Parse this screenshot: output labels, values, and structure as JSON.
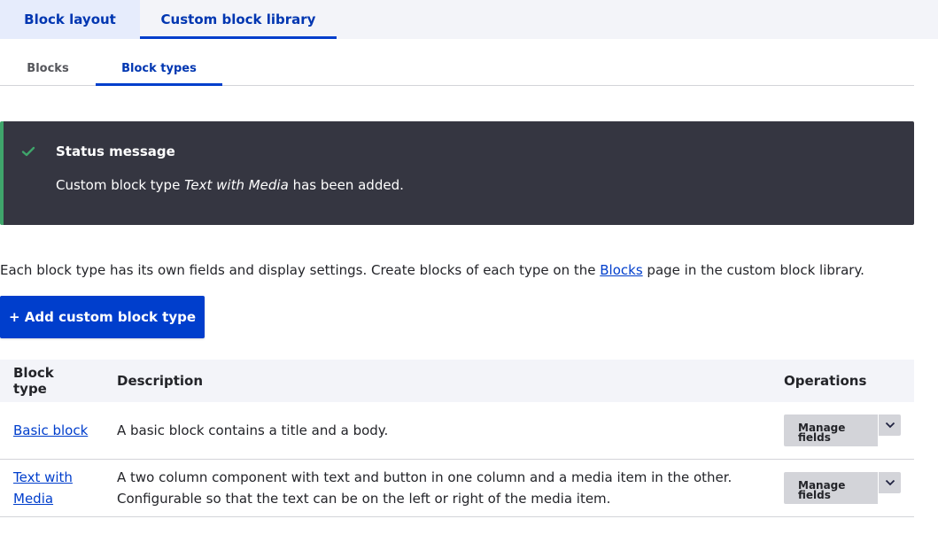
{
  "primary_tabs": [
    {
      "label": "Block layout",
      "active": false
    },
    {
      "label": "Custom block library",
      "active": true
    }
  ],
  "secondary_tabs": [
    {
      "label": "Blocks",
      "active": false
    },
    {
      "label": "Block types",
      "active": true
    }
  ],
  "status": {
    "title": "Status message",
    "message_before": "Custom block type ",
    "message_emphasis": "Text with Media",
    "message_after": " has been added.",
    "icon": "check-icon",
    "accent_color": "#3fa56b"
  },
  "intro": {
    "text_before": "Each block type has its own fields and display settings. Create blocks of each type on the ",
    "link_text": "Blocks",
    "text_after": " page in the custom block library."
  },
  "add_button": {
    "label": "+ Add custom block type",
    "color": "#003ecc"
  },
  "table": {
    "headers": [
      "Block type",
      "Description",
      "Operations"
    ],
    "rows": [
      {
        "type": "Basic block",
        "description": "A basic block contains a title and a body.",
        "operation": "Manage fields"
      },
      {
        "type": "Text with Media",
        "description_line1": "A two column component with text and button in one column and a media item in the other.",
        "description_line2": "Configurable so that the text can be on the left or right of the media item.",
        "operation": "Manage fields"
      }
    ],
    "operation_line1": "Manage",
    "operation_line2": "fields"
  }
}
